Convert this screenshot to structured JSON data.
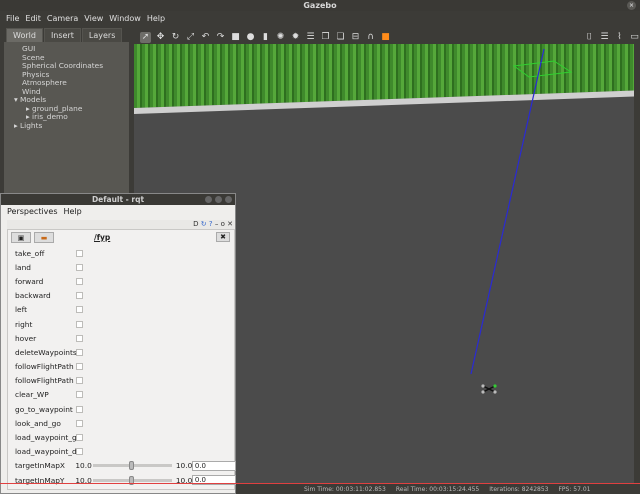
{
  "gazebo": {
    "window_title": "Gazebo",
    "menu": [
      "File",
      "Edit",
      "Camera",
      "View",
      "Window",
      "Help"
    ],
    "tabs": [
      "World",
      "Insert",
      "Layers"
    ],
    "tree": [
      {
        "label": "GUI",
        "indent": 1
      },
      {
        "label": "Scene",
        "indent": 1
      },
      {
        "label": "Spherical Coordinates",
        "indent": 1
      },
      {
        "label": "Physics",
        "indent": 1
      },
      {
        "label": "Atmosphere",
        "indent": 1
      },
      {
        "label": "Wind",
        "indent": 1
      },
      {
        "label": "▾ Models",
        "indent": 0
      },
      {
        "label": "▸ ground_plane",
        "indent": 2
      },
      {
        "label": "▸ iris_demo",
        "indent": 2
      },
      {
        "label": "▸ Lights",
        "indent": 0
      }
    ],
    "statusbar": {
      "sim_time": "Sim Time: 00:03:11:02.853",
      "real_time": "Real Time: 00:03:15:24.455",
      "iterations": "Iterations: 8242853",
      "fps": "FPS: 57.01"
    }
  },
  "rqt": {
    "window_title": "Default - rqt",
    "menu": [
      "Perspectives",
      "Help"
    ],
    "namespace": "/fyp",
    "buttons": [
      "take_off",
      "land",
      "forward",
      "backward",
      "left",
      "right",
      "hover",
      "deleteWaypoints",
      "followFlightPath",
      "followFlightPath",
      "clear_WP",
      "go_to_waypoint",
      "look_and_go",
      "load_waypoint_g",
      "load_waypoint_d"
    ],
    "sliders": [
      {
        "label": "targetInMapX",
        "min": "10.0",
        "max": "10.0",
        "value": "0.0",
        "fraction": 0.5
      },
      {
        "label": "targetInMapY",
        "min": "10.0",
        "max": "10.0",
        "value": "0.0",
        "fraction": 0.5
      }
    ]
  },
  "colors": {
    "accent": "#ff8c1a",
    "grass": "#4f9a34",
    "ground": "#4b4b4b",
    "selection_blue": "#3030d0"
  }
}
